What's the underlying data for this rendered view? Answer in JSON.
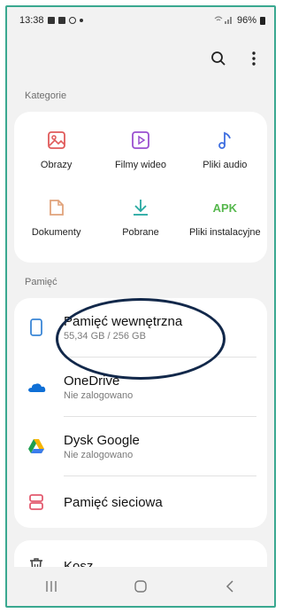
{
  "status": {
    "time": "13:38",
    "battery": "96%"
  },
  "appbar": {
    "search_icon": "search-icon",
    "more_icon": "more-vert-icon"
  },
  "categories": {
    "title": "Kategorie",
    "items": [
      {
        "label": "Obrazy",
        "icon": "image-icon",
        "color": "#e05a5a"
      },
      {
        "label": "Filmy wideo",
        "icon": "video-icon",
        "color": "#9a4fd0"
      },
      {
        "label": "Pliki audio",
        "icon": "music-icon",
        "color": "#3f6fe0"
      },
      {
        "label": "Dokumenty",
        "icon": "document-icon",
        "color": "#e1a37b"
      },
      {
        "label": "Pobrane",
        "icon": "download-icon",
        "color": "#25a8a0"
      },
      {
        "label": "Pliki instalacyjne",
        "icon": "apk-icon",
        "color": "#57b84e",
        "badge": "APK"
      }
    ]
  },
  "storage": {
    "title": "Pamięć",
    "items": [
      {
        "title": "Pamięć wewnętrzna",
        "subtitle": "55,34 GB / 256 GB"
      },
      {
        "title": "OneDrive",
        "subtitle": "Nie zalogowano"
      },
      {
        "title": "Dysk Google",
        "subtitle": "Nie zalogowano"
      },
      {
        "title": "Pamięć sieciowa"
      }
    ]
  },
  "trash": {
    "title": "Kosz"
  },
  "navbar": {
    "recent": "recent-apps-icon",
    "home": "home-icon",
    "back": "back-icon"
  }
}
